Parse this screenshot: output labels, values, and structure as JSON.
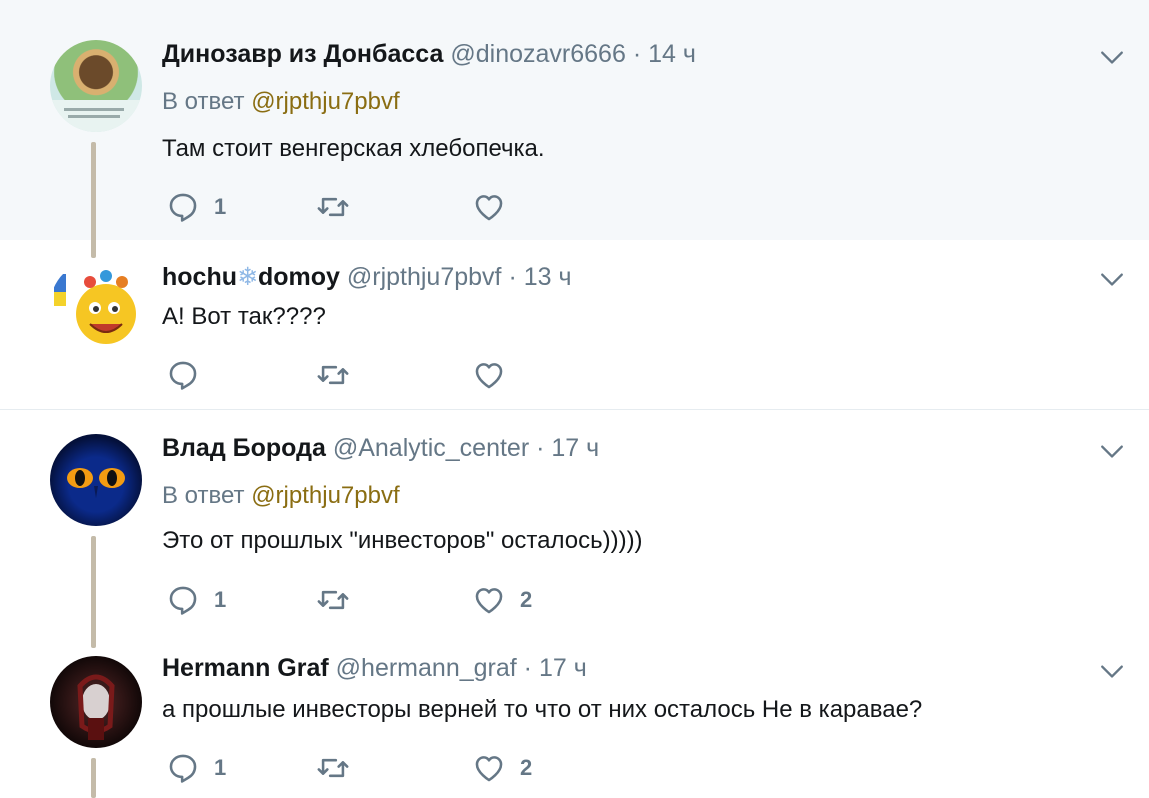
{
  "tweets": [
    {
      "name": "Динозавр из Донбасса",
      "handle": "@dinozavr6666",
      "time": "14 ч",
      "reply_prefix": "В ответ",
      "reply_handle": "@rjpthju7pbvf",
      "text": "Там стоит венгерская хлебопечка.",
      "replies": "1",
      "retweets": "",
      "likes": ""
    },
    {
      "name_part1": "hochu",
      "name_part2": "domoy",
      "handle": "@rjpthju7pbvf",
      "time": "13 ч",
      "text": "А! Вот так????",
      "replies": "",
      "retweets": "",
      "likes": ""
    },
    {
      "name": "Влад Борода",
      "handle": "@Analytic_center",
      "time": "17 ч",
      "reply_prefix": "В ответ",
      "reply_handle": "@rjpthju7pbvf",
      "text": "Это от прошлых \"инвесторов\" осталось)))))",
      "replies": "1",
      "retweets": "",
      "likes": "2"
    },
    {
      "name": "Hermann Graf",
      "handle": "@hermann_graf",
      "time": "17 ч",
      "text": "а прошлые инвесторы верней то что от них осталось Не в каравае?",
      "replies": "1",
      "retweets": "",
      "likes": "2"
    }
  ],
  "separator": "·",
  "snowflake": "❄",
  "colors": {
    "highlight_bg": "#f5f8fa",
    "muted": "#657786",
    "reply_link": "#8a6d12",
    "thread_line": "#c4bba9"
  },
  "icons": [
    "reply-icon",
    "retweet-icon",
    "like-icon",
    "chevron-down-icon"
  ]
}
